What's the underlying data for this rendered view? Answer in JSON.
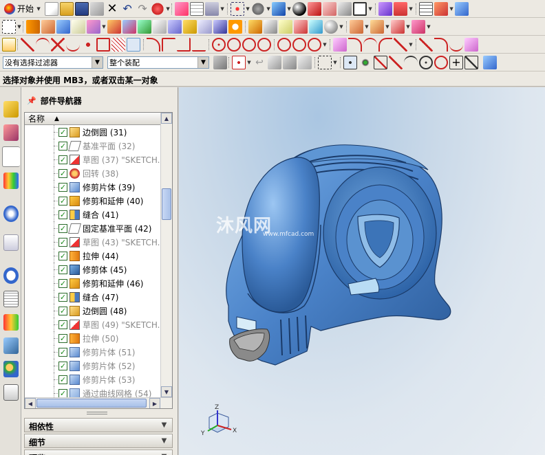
{
  "toolbar": {
    "start_label": "开始"
  },
  "filter_bar": {
    "selection_filter": "没有选择过滤器",
    "assembly_scope": "整个装配"
  },
  "status": {
    "prompt": "选择对象并使用 MB3，或者双击某一对象"
  },
  "navigator": {
    "title": "部件导航器",
    "column_name": "名称",
    "items": [
      {
        "label": "边倒圆 (31)",
        "enabled": true,
        "icon": "edge-blend-icon"
      },
      {
        "label": "基准平面 (32)",
        "enabled": false,
        "icon": "datum-plane-icon"
      },
      {
        "label": "草图 (37) \"SKETCH...",
        "enabled": false,
        "icon": "sketch-icon"
      },
      {
        "label": "回转 (38)",
        "enabled": false,
        "icon": "revolve-icon"
      },
      {
        "label": "修剪片体 (39)",
        "enabled": true,
        "icon": "trim-sheet-icon"
      },
      {
        "label": "修剪和延伸 (40)",
        "enabled": true,
        "icon": "trim-extend-icon"
      },
      {
        "label": "缝合 (41)",
        "enabled": true,
        "icon": "sew-icon"
      },
      {
        "label": "固定基准平面 (42)",
        "enabled": true,
        "icon": "fixed-datum-plane-icon"
      },
      {
        "label": "草图 (43) \"SKETCH...",
        "enabled": false,
        "icon": "sketch-icon"
      },
      {
        "label": "拉伸 (44)",
        "enabled": true,
        "icon": "extrude-icon"
      },
      {
        "label": "修剪体 (45)",
        "enabled": true,
        "icon": "trim-body-icon"
      },
      {
        "label": "修剪和延伸 (46)",
        "enabled": true,
        "icon": "trim-extend-icon"
      },
      {
        "label": "缝合 (47)",
        "enabled": true,
        "icon": "sew-icon"
      },
      {
        "label": "边倒圆 (48)",
        "enabled": true,
        "icon": "edge-blend-icon"
      },
      {
        "label": "草图 (49) \"SKETCH...",
        "enabled": false,
        "icon": "sketch-icon"
      },
      {
        "label": "拉伸 (50)",
        "enabled": false,
        "icon": "extrude-icon"
      },
      {
        "label": "修剪片体 (51)",
        "enabled": false,
        "icon": "trim-sheet-icon"
      },
      {
        "label": "修剪片体 (52)",
        "enabled": false,
        "icon": "trim-sheet-icon"
      },
      {
        "label": "修剪片体 (53)",
        "enabled": false,
        "icon": "trim-sheet-icon"
      },
      {
        "label": "通过曲线网格 (54)",
        "enabled": false,
        "icon": "through-curve-mesh-icon"
      }
    ],
    "panels": [
      {
        "label": "相依性"
      },
      {
        "label": "细节"
      },
      {
        "label": "预览"
      }
    ]
  },
  "viewport": {
    "watermark_main": "沐风网",
    "watermark_url": "www.mfcad.com",
    "triad": {
      "x_label": "X",
      "y_label": "Y",
      "z_label": "Z"
    }
  },
  "colors": {
    "model_blue": "#4a82c8",
    "model_dark": "#2a5a98",
    "toolbar_bg": "#ece9e2",
    "check_green": "#1a8a1a"
  }
}
